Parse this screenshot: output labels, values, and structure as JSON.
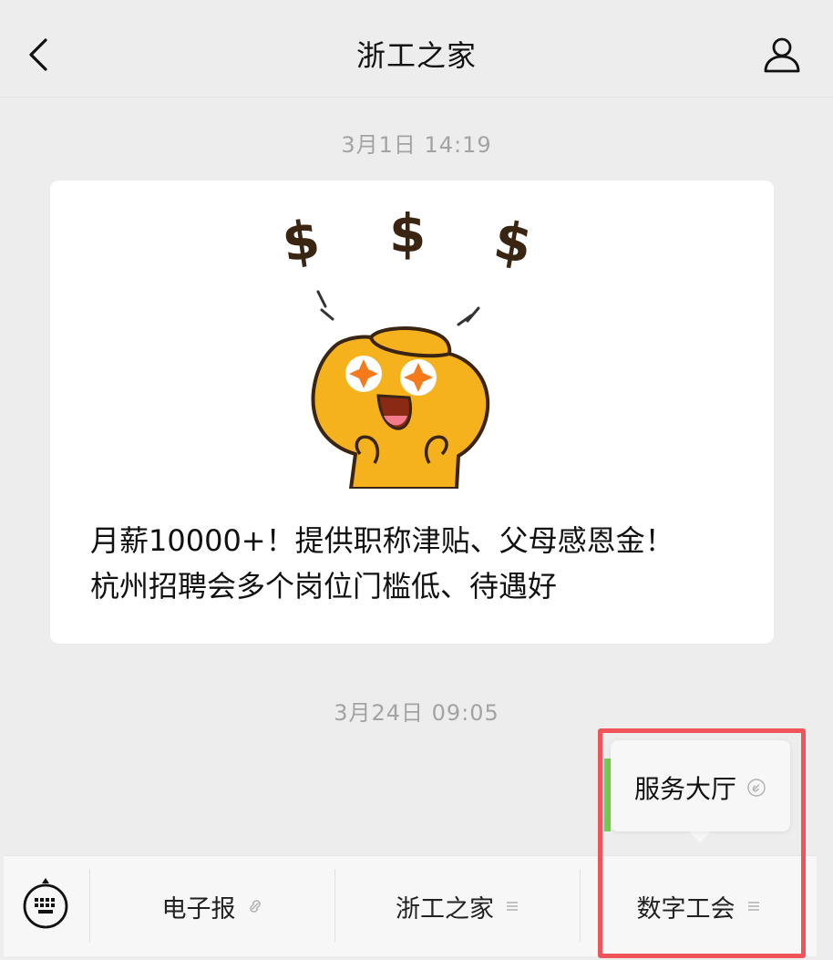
{
  "header": {
    "title": "浙工之家"
  },
  "messages": [
    {
      "timestamp": "3月1日 14:19",
      "card": {
        "title_lines": [
          "月薪10000+！提供职称津贴、父母感恩金！",
          "杭州招聘会多个岗位门槛低、待遇好"
        ],
        "image_icons": [
          "dollar-icon",
          "dollar-icon",
          "dollar-icon",
          "gold-ingot-mascot"
        ]
      }
    },
    {
      "timestamp": "3月24日 09:05"
    }
  ],
  "popup_menu": {
    "items": [
      {
        "label": "服务大厅",
        "icon": "link-icon"
      }
    ]
  },
  "bottom_menu": {
    "items": [
      {
        "label": "电子报",
        "icon": "link-icon"
      },
      {
        "label": "浙工之家",
        "icon": "menu-icon"
      },
      {
        "label": "数字工会",
        "icon": "menu-icon"
      }
    ]
  },
  "colors": {
    "highlight": "#f0545a",
    "background": "#ededed",
    "mascot": "#f6b21c"
  }
}
